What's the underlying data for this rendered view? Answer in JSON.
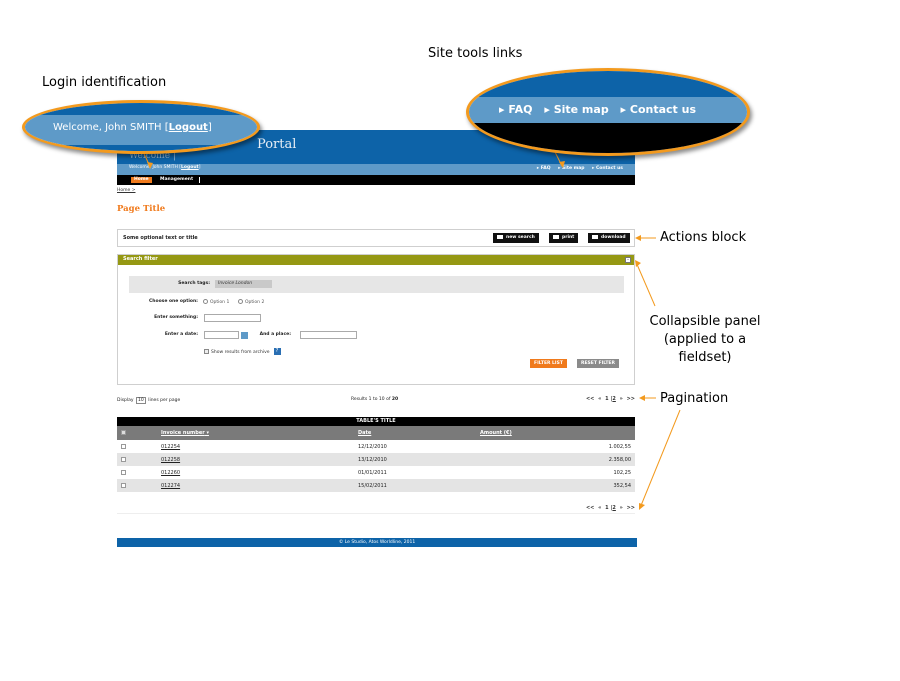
{
  "annotations": {
    "site_tools": "Site tools links",
    "login": "Login identification",
    "actions": "Actions block",
    "collapsible": "Collapsible panel (applied to a fieldset)",
    "pagination": "Pagination"
  },
  "zoom_login": {
    "welcome": "Welcome, John SMITH",
    "logout": "Logout"
  },
  "zoom_tools": {
    "items": [
      "FAQ",
      "Site map",
      "Contact us"
    ]
  },
  "header": {
    "logo": "Portal",
    "sub": "Welcome |",
    "welcome": "Welcome, John SMITH",
    "logout": "Logout",
    "tools": [
      "FAQ",
      "Site map",
      "Contact us"
    ]
  },
  "nav": {
    "home": "Home",
    "management": "Management"
  },
  "breadcrumb": "Home >",
  "page_title": "Page Title",
  "actions": {
    "text": "Some optional text or title",
    "new_search": "new search",
    "print": "print",
    "download": "download"
  },
  "filter": {
    "title": "Search filter",
    "collapse": "-",
    "tags_label": "Search tags:",
    "tag": "Invoice London",
    "option_label": "Choose one option:",
    "option1": "Option 1",
    "option2": "Option 2",
    "something_label": "Enter something:",
    "date_label": "Enter a date:",
    "place_label": "And a place:",
    "archive": "Show results from archive",
    "help": "?",
    "filter_btn": "FILTER LIST",
    "reset_btn": "RESET FILTER"
  },
  "pagination": {
    "display": "Display",
    "per_page_value": "10",
    "per_page": "lines per page",
    "results": "Results 1 to 10 of",
    "total": "20",
    "first": "<<",
    "prev": "«",
    "page1": "1",
    "sep": "|",
    "page2": "2",
    "next": "»",
    "last": ">>"
  },
  "table": {
    "title": "TABLE'S TITLE",
    "headers": [
      "Invoice number",
      "Date",
      "Amount (€)"
    ],
    "rows": [
      {
        "invoice": "012254",
        "date": "12/12/2010",
        "amount": "1.002,55"
      },
      {
        "invoice": "012258",
        "date": "13/12/2010",
        "amount": "2.358,00"
      },
      {
        "invoice": "012260",
        "date": "01/01/2011",
        "amount": "102,25"
      },
      {
        "invoice": "012274",
        "date": "15/02/2011",
        "amount": "352,54"
      }
    ]
  },
  "footer": "© Le Studio, Atos Worldline, 2011",
  "colors": {
    "brand_blue": "#0d63a8",
    "light_blue": "#5e9ac8",
    "accent_orange": "#f07a1c",
    "filter_olive": "#959813",
    "callout_orange": "#f39a1e"
  }
}
